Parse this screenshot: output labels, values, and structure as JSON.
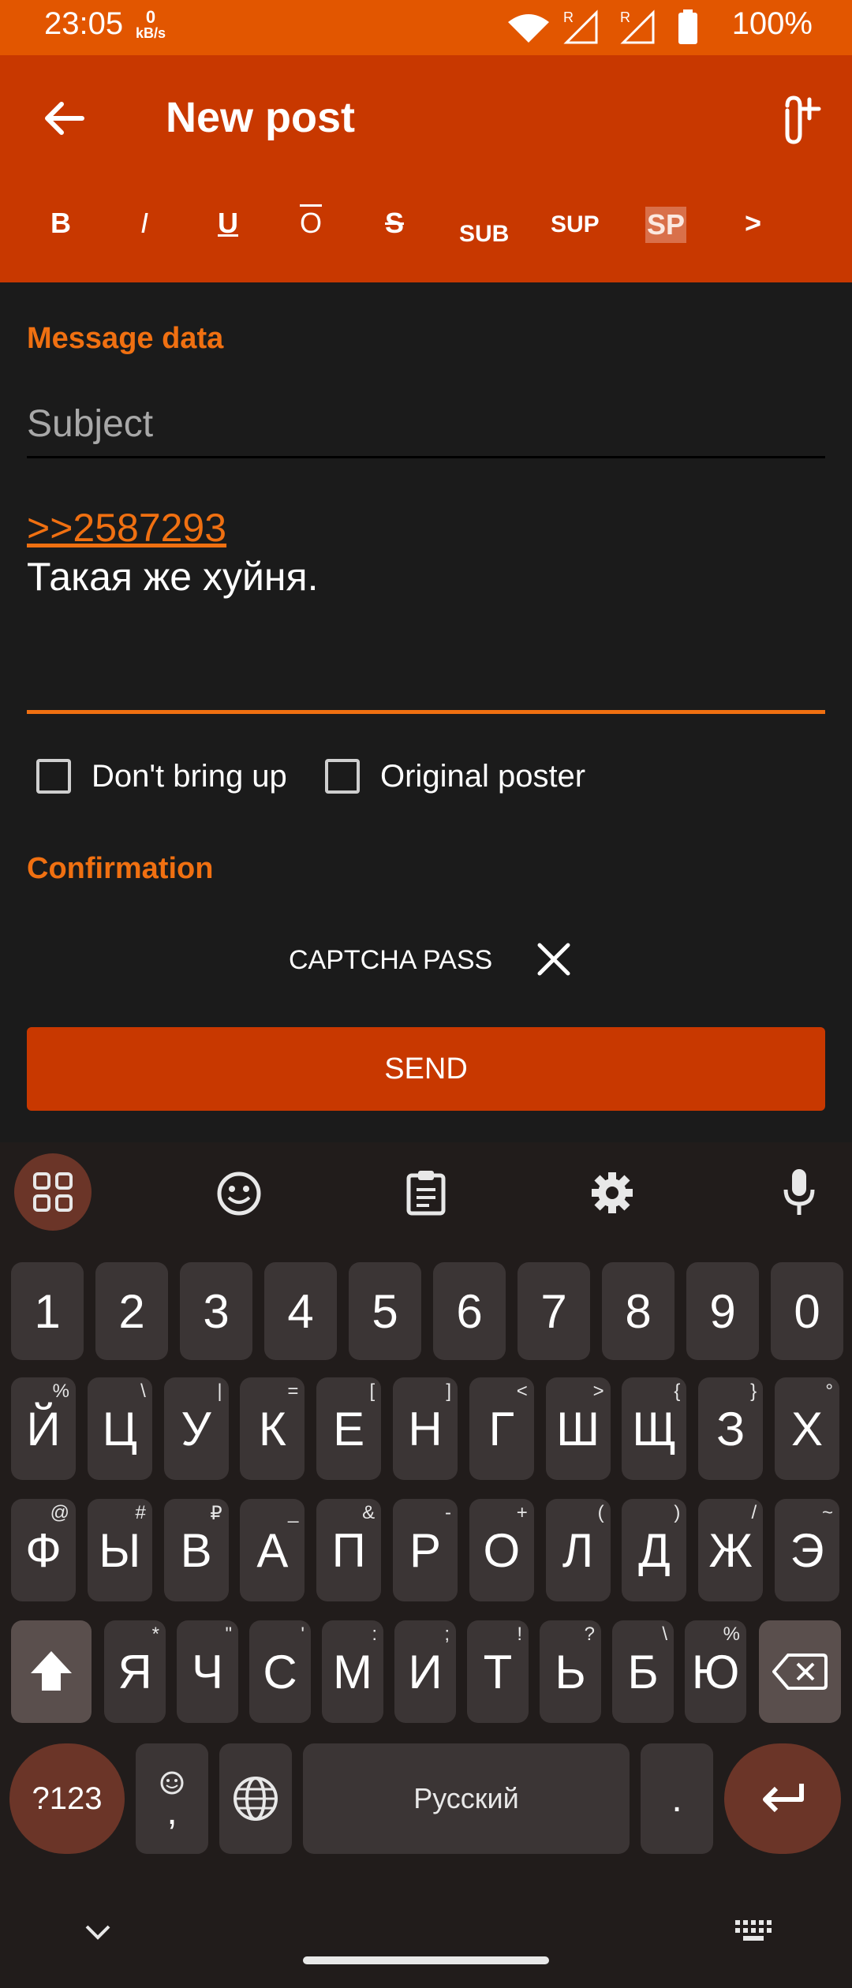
{
  "status_bar": {
    "time": "23:05",
    "speed_value": "0",
    "speed_unit": "kB/s",
    "battery": "100%"
  },
  "app_bar": {
    "title": "New post",
    "format_buttons": [
      "B",
      "I",
      "U",
      "O",
      "S",
      "SUB",
      "SUP",
      "SP",
      ">"
    ]
  },
  "form": {
    "message_section": "Message data",
    "subject_placeholder": "Subject",
    "message_link": ">>2587293",
    "message_text": "Такая же хуйня.",
    "dont_bring_up": "Don't bring up",
    "original_poster": "Original poster",
    "confirmation_section": "Confirmation",
    "captcha_label": "CAPTCHA PASS",
    "send_label": "SEND"
  },
  "keyboard": {
    "numbers": [
      "1",
      "2",
      "3",
      "4",
      "5",
      "6",
      "7",
      "8",
      "9",
      "0"
    ],
    "row1": [
      [
        "Й",
        "%"
      ],
      [
        "Ц",
        "\\"
      ],
      [
        "У",
        "|"
      ],
      [
        "К",
        "="
      ],
      [
        "Е",
        "["
      ],
      [
        "Н",
        "]"
      ],
      [
        "Г",
        "<"
      ],
      [
        "Ш",
        ">"
      ],
      [
        "Щ",
        "{"
      ],
      [
        "З",
        "}"
      ],
      [
        "Х",
        "°"
      ]
    ],
    "row2": [
      [
        "Ф",
        "@"
      ],
      [
        "Ы",
        "#"
      ],
      [
        "В",
        "₽"
      ],
      [
        "А",
        "_"
      ],
      [
        "П",
        "&"
      ],
      [
        "Р",
        "-"
      ],
      [
        "О",
        "+"
      ],
      [
        "Л",
        "("
      ],
      [
        "Д",
        ")"
      ],
      [
        "Ж",
        "/"
      ],
      [
        "Э",
        "~"
      ]
    ],
    "row3": [
      [
        "Я",
        "*"
      ],
      [
        "Ч",
        "\""
      ],
      [
        "С",
        "'"
      ],
      [
        "М",
        ":"
      ],
      [
        "И",
        ";"
      ],
      [
        "Т",
        "!"
      ],
      [
        "Ь",
        "?"
      ],
      [
        "Б",
        "\\"
      ],
      [
        "Ю",
        "%"
      ]
    ],
    "symbols_key": "?123",
    "comma_key": ",",
    "space_label": "Русский",
    "period_key": "."
  },
  "colors": {
    "status_bar": "#e25600",
    "app_bar": "#c83800",
    "accent": "#f07011",
    "background": "#1b1b1b",
    "keyboard_bg": "#211c1b",
    "key_bg": "#3b3535",
    "special_key_bg": "#6b3528"
  }
}
